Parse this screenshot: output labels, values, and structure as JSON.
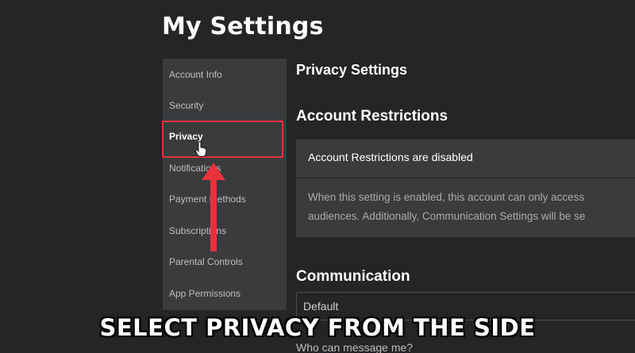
{
  "page": {
    "title": "My Settings"
  },
  "sidebar": {
    "items": [
      {
        "label": "Account Info",
        "active": false
      },
      {
        "label": "Security",
        "active": false
      },
      {
        "label": "Privacy",
        "active": true
      },
      {
        "label": "Notifications",
        "active": false
      },
      {
        "label": "Payment Methods",
        "active": false
      },
      {
        "label": "Subscriptions",
        "active": false
      },
      {
        "label": "Parental Controls",
        "active": false
      },
      {
        "label": "App Permissions",
        "active": false
      }
    ]
  },
  "main": {
    "heading": "Privacy Settings",
    "account_restrictions": {
      "heading": "Account Restrictions",
      "status": "Account Restrictions are disabled",
      "description_line1": "When this setting is enabled, this account can only access",
      "description_line2": "audiences. Additionally, Communication Settings will be se"
    },
    "communication": {
      "heading": "Communication",
      "select_value": "Default",
      "sub_label": "Who can message me?"
    }
  },
  "overlay": {
    "caption": "SELECT PRIVACY FROM THE SIDE",
    "highlight_color": "#e8323c",
    "icons": [
      "hand-cursor-icon",
      "up-arrow-icon"
    ]
  }
}
